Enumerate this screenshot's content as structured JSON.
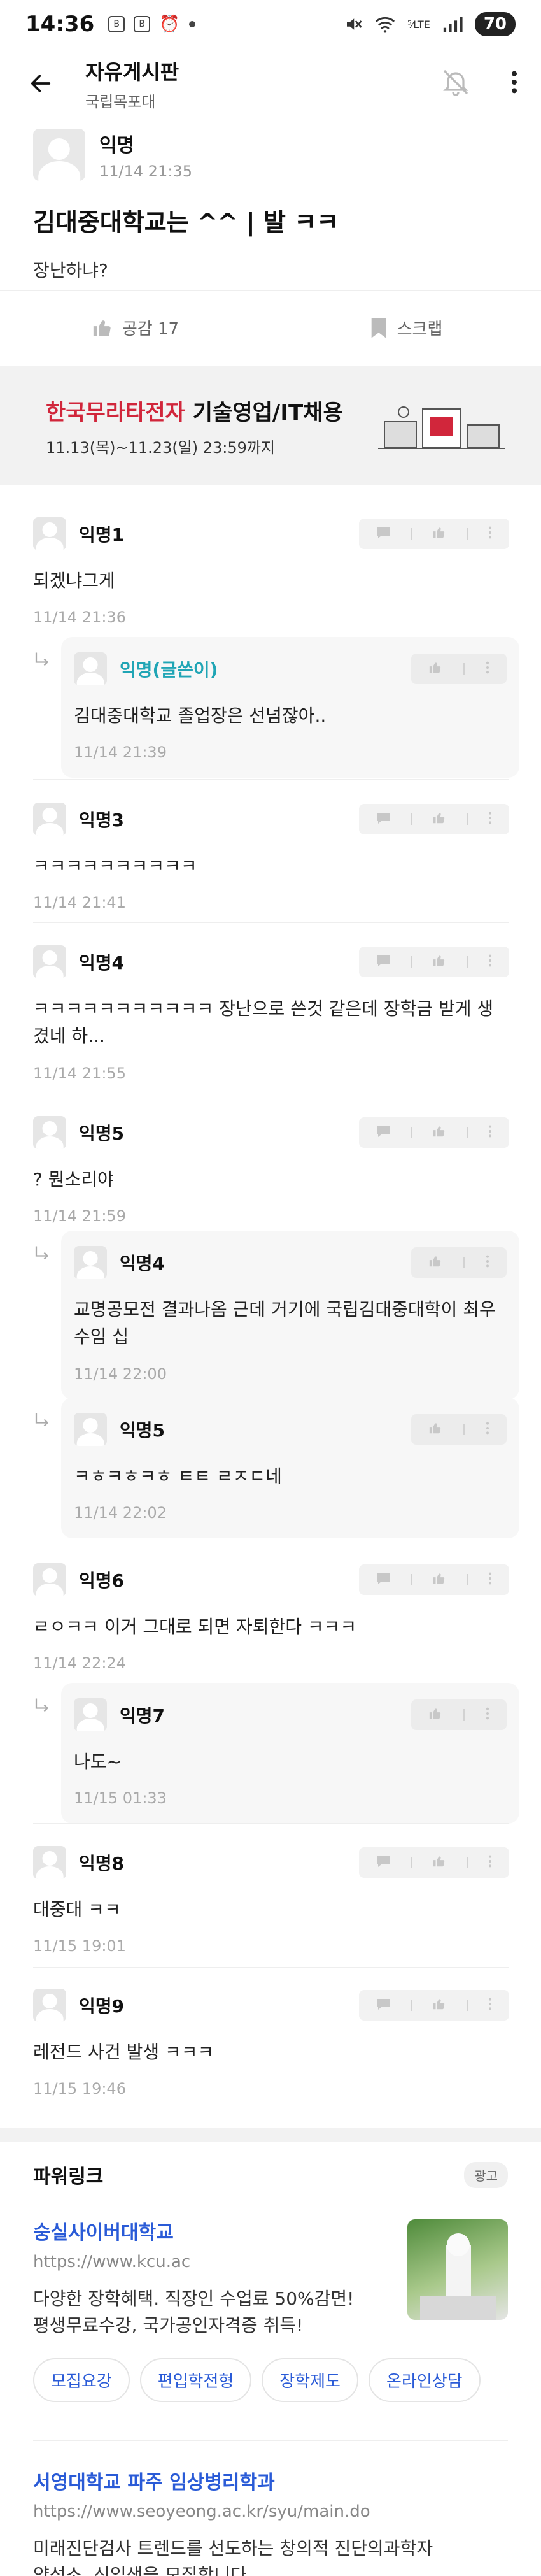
{
  "status_bar": {
    "time": "14:36",
    "left_icons": [
      "B",
      "B",
      "⏰"
    ],
    "network": "⁵⁄LTE",
    "battery": "70"
  },
  "header": {
    "title": "자유게시판",
    "subtitle": "국립목포대"
  },
  "post": {
    "author": "익명",
    "time": "11/14 21:35",
    "title": "김대중대학교는 ^^ | 발 ㅋㅋ",
    "body": "장난하냐?"
  },
  "actions": {
    "like_label": "공감 17",
    "scrap_label": "스크랩"
  },
  "ad_banner": {
    "brand": "한국무라타전자",
    "headline_rest": " 기술영업/IT채용",
    "dates": "11.13(목)~11.23(일) 23:59까지"
  },
  "comments": [
    {
      "name": "익명1",
      "text": "되겠냐그게",
      "time": "11/14 21:36",
      "reply": false,
      "op": false
    },
    {
      "name": "익명(글쓴이)",
      "text": "김대중대학교 졸업장은 선넘잖아..",
      "time": "11/14 21:39",
      "reply": true,
      "op": true
    },
    {
      "name": "익명3",
      "text": "ㅋㅋㅋㅋㅋㅋㅋㅋㅋㅋ",
      "time": "11/14 21:41",
      "reply": false,
      "op": false
    },
    {
      "name": "익명4",
      "text": "ㅋㅋㅋㅋㅋㅋㅋㅋㅋㅋㅋ 장난으로 쓴것 같은데 장학금 받게 생겼네 하...",
      "time": "11/14 21:55",
      "reply": false,
      "op": false
    },
    {
      "name": "익명5",
      "text": "? 뭔소리야",
      "time": "11/14 21:59",
      "reply": false,
      "op": false
    },
    {
      "name": "익명4",
      "text": "교명공모전 결과나옴 근데 거기에 국립김대중대학이 최우수임 십",
      "time": "11/14 22:00",
      "reply": true,
      "op": false
    },
    {
      "name": "익명5",
      "text": "ㅋㅎㅋㅎㅋㅎ ㅌㅌ ㄹㅈㄷ네",
      "time": "11/14 22:02",
      "reply": true,
      "op": false
    },
    {
      "name": "익명6",
      "text": "ㄹㅇㅋㅋ 이거 그대로 되면 자퇴한다 ㅋㅋㅋ",
      "time": "11/14 22:24",
      "reply": false,
      "op": false
    },
    {
      "name": "익명7",
      "text": "나도~",
      "time": "11/15 01:33",
      "reply": true,
      "op": false
    },
    {
      "name": "익명8",
      "text": "대중대 ㅋㅋ",
      "time": "11/15 19:01",
      "reply": false,
      "op": false
    },
    {
      "name": "익명9",
      "text": "레전드 사건 발생 ㅋㅋㅋ",
      "time": "11/15 19:46",
      "reply": false,
      "op": false
    }
  ],
  "powerlink": {
    "title": "파워링크",
    "badge": "광고",
    "ad1": {
      "title": "숭실사이버대학교",
      "url": "https://www.kcu.ac",
      "desc_line1": "다양한 장학혜택. 직장인 수업료 50%감면!",
      "desc_line2": "평생무료수강, 국가공인자격증 취득!",
      "chips": [
        "모집요강",
        "편입학전형",
        "장학제도",
        "온라인상담"
      ]
    },
    "ad2": {
      "title": "서영대학교 파주 임상병리학과",
      "url": "https://www.seoyeong.ac.kr/syu/main.do",
      "desc_line1": "미래진단검사 트렌드를 선도하는 창의적 진단의과학자",
      "desc_line2": "양성소, 신입생을 모집합니다"
    }
  }
}
